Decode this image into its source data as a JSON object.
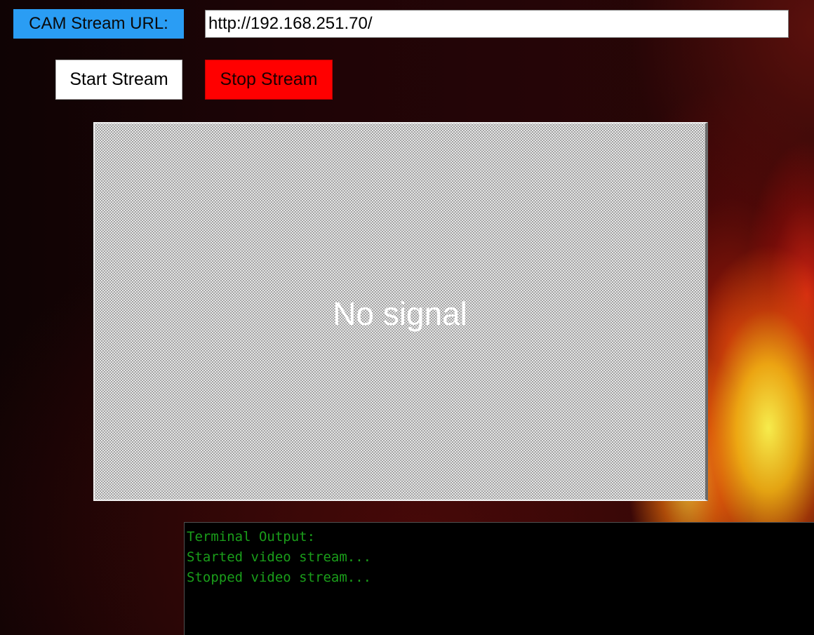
{
  "stream_config": {
    "label": "CAM Stream URL:",
    "url_value": "http://192.168.251.70/"
  },
  "controls": {
    "start_label": "Start Stream",
    "stop_label": "Stop Stream"
  },
  "video": {
    "status_text": "No signal"
  },
  "terminal": {
    "lines": [
      "Terminal Output:",
      "Started video stream...",
      "Stopped video stream..."
    ]
  },
  "colors": {
    "label_bg": "#2a9df4",
    "stop_button_bg": "#ff0000",
    "terminal_text": "#1a9e1a"
  }
}
